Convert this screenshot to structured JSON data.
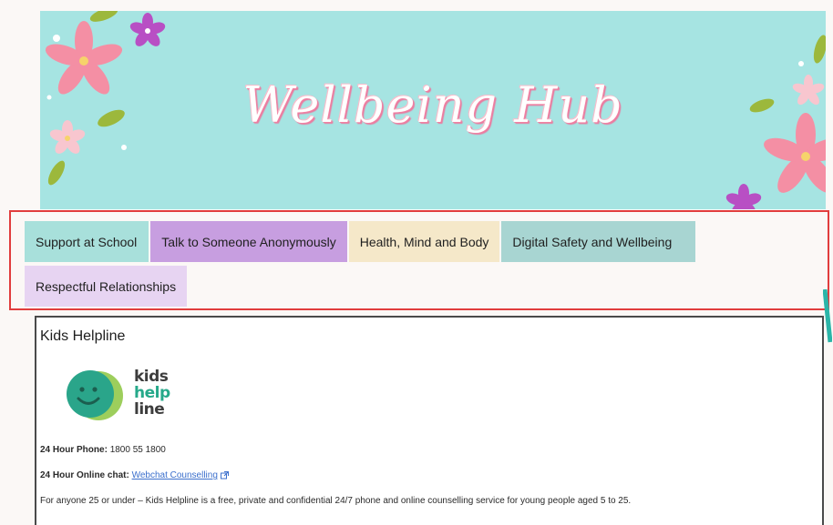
{
  "banner": {
    "title": "Wellbeing Hub"
  },
  "nav": {
    "tabs": [
      {
        "label": "Support at School",
        "color": "#a8e0db"
      },
      {
        "label": "Talk to Someone Anonymously",
        "color": "#c79ee0"
      },
      {
        "label": "Health, Mind and Body",
        "color": "#f5e8c9"
      },
      {
        "label": "Digital Safety and Wellbeing",
        "color": "#a8d5d2"
      },
      {
        "label": "Respectful Relationships",
        "color": "#e7d4f2"
      }
    ],
    "highlight_color": "#e13d3d"
  },
  "content": {
    "heading": "Kids Helpline",
    "logo": {
      "line1": "kids",
      "line2": "help",
      "line3": "line"
    },
    "phone_label": "24 Hour Phone:",
    "phone_value": "1800 55 1800",
    "chat_label": "24 Hour Online chat:",
    "chat_link": "Webchat Counselling",
    "chat_icon": "external-link-icon",
    "description": "For anyone 25 or under – Kids Helpline is a free, private and confidential 24/7 phone and online counselling service for young people aged 5 to 25."
  }
}
